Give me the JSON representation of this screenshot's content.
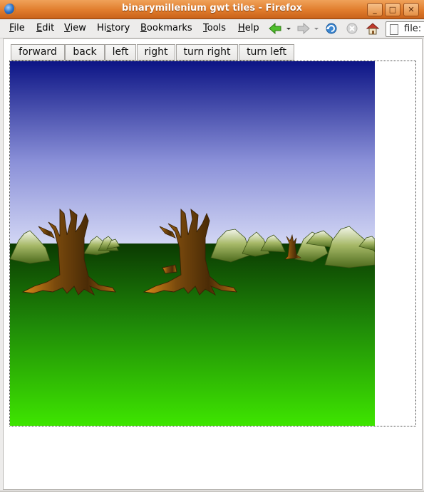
{
  "window": {
    "title": "binarymillenium gwt tiles - Firefox",
    "minimize": "_",
    "maximize": "□",
    "close": "✕"
  },
  "menu": [
    "File",
    "Edit",
    "View",
    "History",
    "Bookmarks",
    "Tools",
    "Help"
  ],
  "menu_mnemonics": [
    "F",
    "E",
    "V",
    "s",
    "B",
    "T",
    "H"
  ],
  "urlbar": {
    "value": "file:"
  },
  "toolbar": {
    "forward": "forward",
    "back": "back",
    "left": "left",
    "right": "right",
    "turn_right": "turn right",
    "turn_left": "turn left"
  },
  "colors": {
    "titlebar": "#e07c2c",
    "sky_top": "#0c1485",
    "sky_horizon": "#d2d6f4",
    "ground_top": "#0b3a02",
    "ground_bottom": "#3ee500"
  },
  "icons": [
    "browser-globe-icon",
    "back-arrow-icon",
    "forward-arrow-icon",
    "reload-icon",
    "stop-icon",
    "home-icon",
    "page-icon"
  ]
}
